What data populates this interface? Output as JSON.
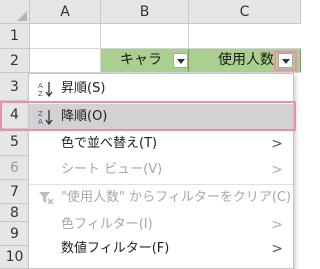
{
  "columns": [
    "A",
    "B",
    "C"
  ],
  "rows": [
    "1",
    "2",
    "3",
    "4",
    "5",
    "6",
    "7",
    "8",
    "9",
    "10"
  ],
  "headers": {
    "b2": "キャラ",
    "c2": "使用人数"
  },
  "menu": {
    "sort_asc": "昇順(S)",
    "sort_desc": "降順(O)",
    "sort_by_color": "色で並べ替え(T)",
    "sheet_view": "シート ビュー(V)",
    "clear_filter": "\"使用人数\" からフィルターをクリア(C)",
    "color_filter": "色フィルター(I)",
    "number_filter": "数値フィルター(F)"
  },
  "colors": {
    "header_fill": "#a9d08e",
    "highlight_border": "#f08cb0",
    "hover_fill": "#d2d2d2"
  },
  "icons": {
    "sort_asc": "sort-ascending-icon",
    "sort_desc": "sort-descending-icon",
    "clear_filter": "clear-filter-icon",
    "dropdown": "filter-dropdown-icon"
  }
}
